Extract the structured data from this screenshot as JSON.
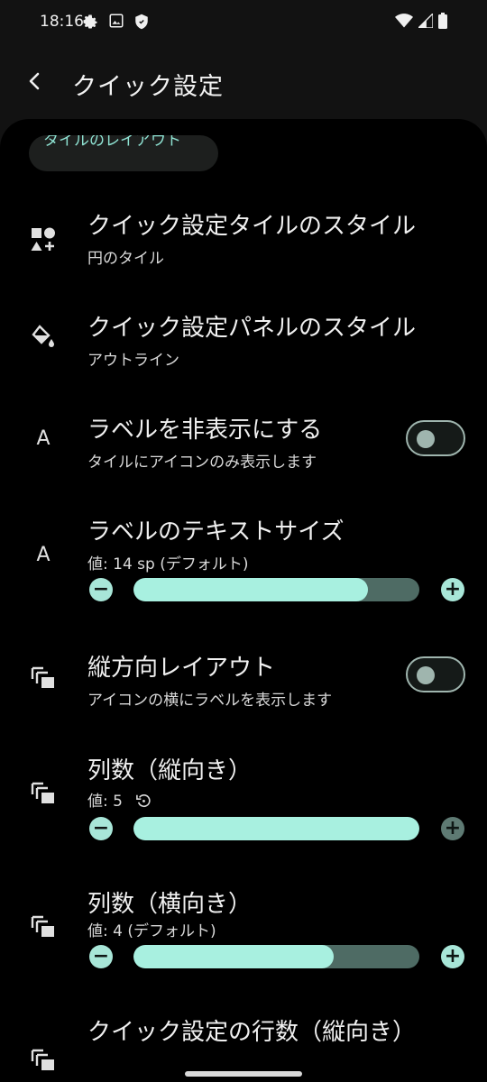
{
  "status_bar": {
    "time": "18:16"
  },
  "toolbar": {
    "title": "クイック設定"
  },
  "category": {
    "label": "タイルのレイアウト"
  },
  "settings": {
    "tile_style": {
      "title": "クイック設定タイルのスタイル",
      "summary": "円のタイル"
    },
    "panel_style": {
      "title": "クイック設定パネルのスタイル",
      "summary": "アウトライン"
    },
    "hide_labels": {
      "title": "ラベルを非表示にする",
      "summary": "タイルにアイコンのみ表示します",
      "checked": false
    },
    "label_size": {
      "title": "ラベルのテキストサイズ",
      "summary": "値: 14 sp (デフォルト)",
      "progress": 0.82
    },
    "vertical_layout": {
      "title": "縦方向レイアウト",
      "summary": "アイコンの横にラベルを表示します",
      "checked": false
    },
    "columns_portrait": {
      "title": "列数（縦向き）",
      "summary": "値: 5",
      "progress": 1.0
    },
    "columns_landscape": {
      "title": "列数（横向き）",
      "summary": "値: 4 (デフォルト)",
      "progress": 0.7
    },
    "rows_portrait": {
      "title": "クイック設定の行数（縦向き）"
    }
  },
  "colors": {
    "accent": "#a8f0e0",
    "track": "#4e6b64",
    "chip_text": "#8fe3d3",
    "background": "#000000"
  },
  "icons": {
    "status": [
      "gear-icon",
      "image-icon",
      "shield-icon",
      "wifi-icon",
      "signal-icon",
      "battery-icon"
    ],
    "rows": [
      "shapes-icon",
      "paint-bucket-icon",
      "text-a-icon",
      "text-a-icon",
      "stacked-squares-icon",
      "stacked-squares-icon",
      "stacked-squares-icon",
      "stacked-squares-icon"
    ],
    "reset": "reset-icon",
    "back": "back-arrow-icon"
  }
}
